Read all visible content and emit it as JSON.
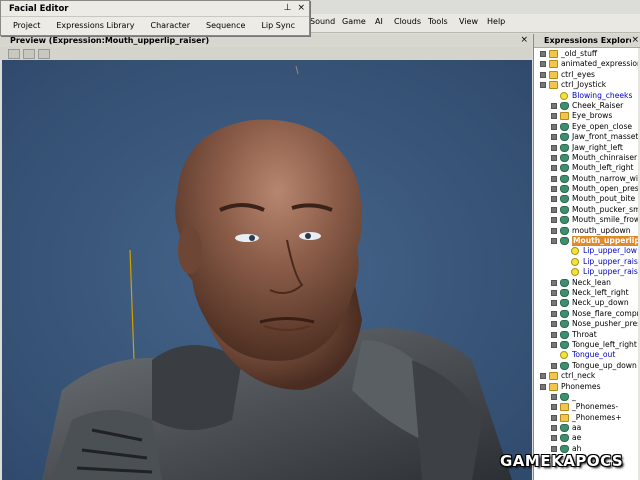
{
  "facial_editor": {
    "title": "Facial Editor",
    "title_buttons": [
      "⊥",
      "×"
    ],
    "menu": [
      "Project",
      "Expressions Library",
      "Character",
      "Sequence",
      "Lip Sync"
    ]
  },
  "main_menu": [
    "Sound",
    "Game",
    "AI",
    "Clouds",
    "Tools",
    "View",
    "Help"
  ],
  "preview": {
    "title": "Preview (Expression:Mouth_upperlip_raiser)",
    "close": "×"
  },
  "explorer": {
    "title": "Expressions Explorer - character",
    "close": "×",
    "items": [
      {
        "label": "_old_stuff",
        "icon": "folder-icon",
        "level": 0,
        "expander": true
      },
      {
        "label": "animated_expressions",
        "icon": "folder-icon",
        "level": 0,
        "expander": true
      },
      {
        "label": "ctrl_eyes",
        "icon": "folder-icon",
        "level": 0,
        "expander": true
      },
      {
        "label": "ctrl_Joystick",
        "icon": "folder-open-icon",
        "level": 0,
        "expander": true
      },
      {
        "label": "Blowing_cheeks",
        "icon": "smiley-icon",
        "level": 1,
        "expander": false
      },
      {
        "label": "Cheek_Raiser",
        "icon": "mask-icon",
        "level": 1,
        "expander": true
      },
      {
        "label": "Eye_brows",
        "icon": "folder-icon",
        "level": 1,
        "expander": true
      },
      {
        "label": "Eye_open_close",
        "icon": "mask-icon",
        "level": 1,
        "expander": true
      },
      {
        "label": "Jaw_front_masseter",
        "icon": "mask-icon",
        "level": 1,
        "expander": true
      },
      {
        "label": "Jaw_right_left",
        "icon": "mask-icon",
        "level": 1,
        "expander": true
      },
      {
        "label": "Mouth_chinraiser",
        "icon": "mask-icon",
        "level": 1,
        "expander": true
      },
      {
        "label": "Mouth_left_right",
        "icon": "mask-icon",
        "level": 1,
        "expander": true
      },
      {
        "label": "Mouth_narrow_wide",
        "icon": "mask-icon",
        "level": 1,
        "expander": true
      },
      {
        "label": "Mouth_open_press",
        "icon": "mask-icon",
        "level": 1,
        "expander": true
      },
      {
        "label": "Mouth_pout_bite",
        "icon": "mask-icon",
        "level": 1,
        "expander": true
      },
      {
        "label": "Mouth_pucker_smile",
        "icon": "mask-icon",
        "level": 1,
        "expander": true
      },
      {
        "label": "Mouth_smile_frown",
        "icon": "mask-icon",
        "level": 1,
        "expander": true
      },
      {
        "label": "mouth_updown",
        "icon": "mask-icon",
        "level": 1,
        "expander": true
      },
      {
        "label": "Mouth_upperlip_raiser",
        "icon": "mask-icon",
        "level": 1,
        "expander": true,
        "selected": true
      },
      {
        "label": "Lip_upper_low",
        "icon": "smiley-icon",
        "level": 2,
        "expander": false
      },
      {
        "label": "Lip_upper_raise",
        "icon": "smiley-icon",
        "level": 2,
        "expander": false
      },
      {
        "label": "Lip_upper_raise",
        "icon": "smiley-icon",
        "level": 2,
        "expander": false
      },
      {
        "label": "Neck_lean",
        "icon": "mask-icon",
        "level": 1,
        "expander": true
      },
      {
        "label": "Neck_left_right",
        "icon": "mask-icon",
        "level": 1,
        "expander": true
      },
      {
        "label": "Neck_up_down",
        "icon": "mask-icon",
        "level": 1,
        "expander": true
      },
      {
        "label": "Nose_flare_compress",
        "icon": "mask-icon",
        "level": 1,
        "expander": true
      },
      {
        "label": "Nose_pusher_pressed",
        "icon": "mask-icon",
        "level": 1,
        "expander": true
      },
      {
        "label": "Throat",
        "icon": "mask-icon",
        "level": 1,
        "expander": true
      },
      {
        "label": "Tongue_left_right",
        "icon": "mask-icon",
        "level": 1,
        "expander": true
      },
      {
        "label": "Tongue_out",
        "icon": "smiley-icon",
        "level": 1,
        "expander": false
      },
      {
        "label": "Tongue_up_down",
        "icon": "mask-icon",
        "level": 1,
        "expander": true
      },
      {
        "label": "ctrl_neck",
        "icon": "folder-icon",
        "level": 0,
        "expander": true
      },
      {
        "label": "Phonemes",
        "icon": "folder-open-icon",
        "level": 0,
        "expander": true
      },
      {
        "label": "_",
        "icon": "mask-icon",
        "level": 1,
        "expander": true
      },
      {
        "label": "_Phonemes-",
        "icon": "folder-icon",
        "level": 1,
        "expander": true
      },
      {
        "label": "_Phonemes+",
        "icon": "folder-icon",
        "level": 1,
        "expander": true
      },
      {
        "label": "aa",
        "icon": "mask-icon",
        "level": 1,
        "expander": true
      },
      {
        "label": "ae",
        "icon": "mask-icon",
        "level": 1,
        "expander": true
      },
      {
        "label": "ah",
        "icon": "mask-icon",
        "level": 1,
        "expander": true
      }
    ]
  },
  "watermark": "GAMEKAPOCS"
}
